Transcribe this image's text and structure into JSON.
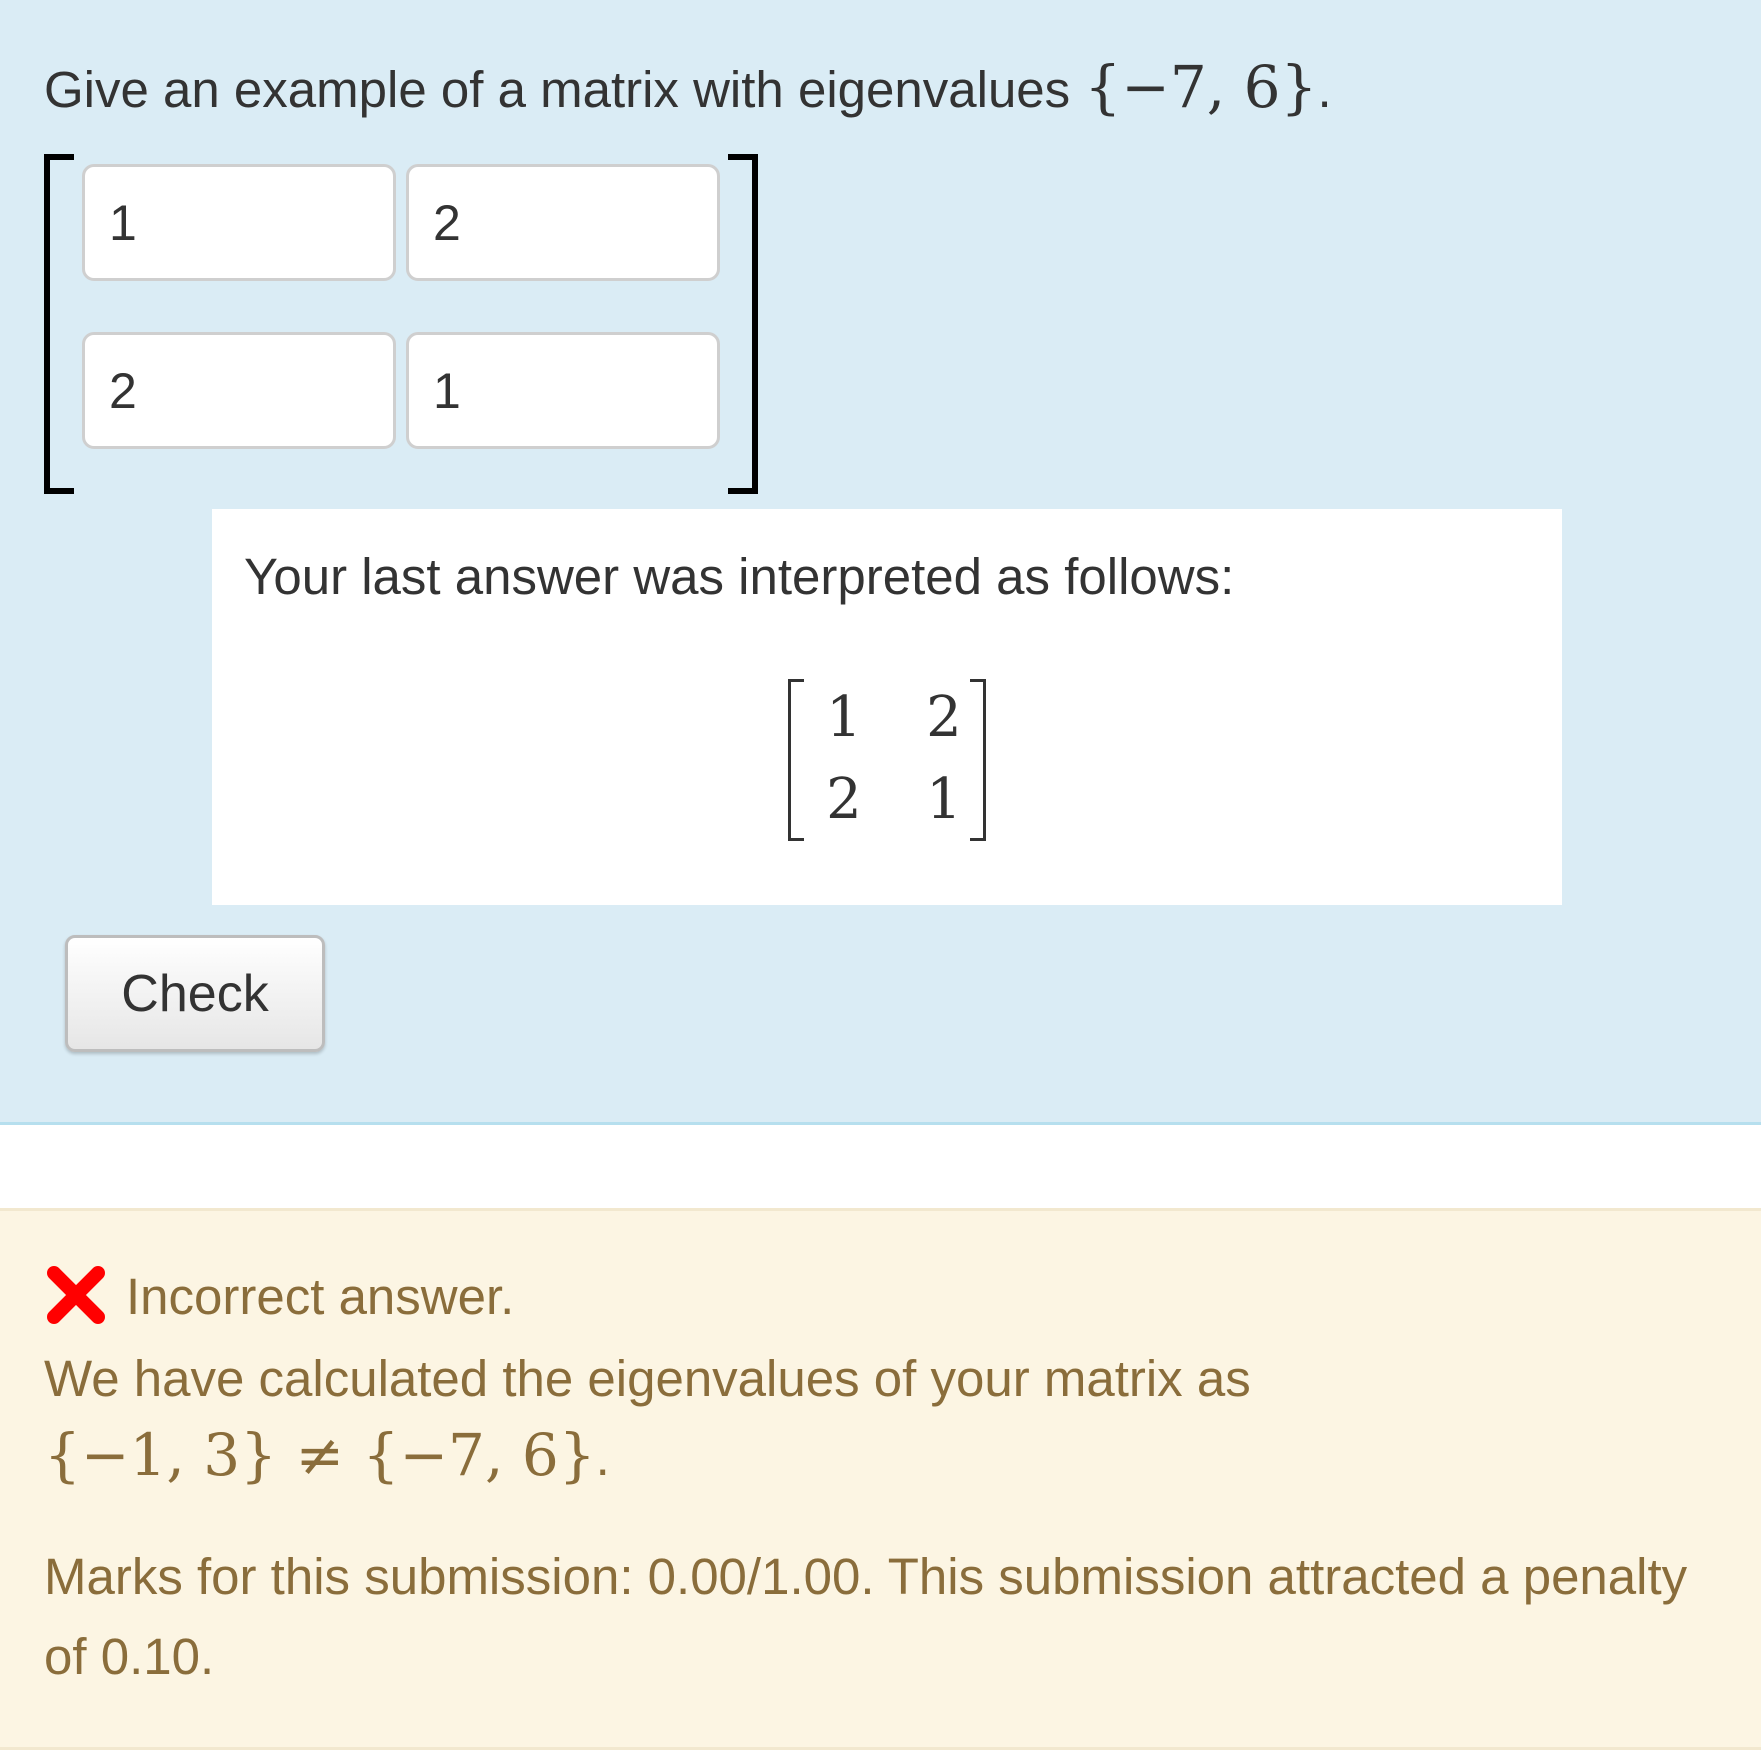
{
  "question": {
    "text": "Give an example of a matrix with eigenvalues ",
    "math": "{−7, 6}",
    "end": "."
  },
  "matrix_inputs": {
    "r1c1": "1",
    "r1c2": "2",
    "r2c1": "2",
    "r2c2": "1"
  },
  "validation": {
    "text": "Your last answer was interpreted as follows:",
    "matrix": {
      "r1c1": "1",
      "r1c2": "2",
      "r2c1": "2",
      "r2c2": "1"
    }
  },
  "check_button": {
    "label": "Check"
  },
  "feedback": {
    "status": "Incorrect answer.",
    "explanation_text": "We have calculated the eigenvalues of your matrix as",
    "explanation_math": "{−1, 3} ≠ {−7, 6}",
    "explanation_end": ".",
    "marks": "Marks for this submission: 0.00/1.00. This submission attracted a penalty of 0.10."
  },
  "colors": {
    "formulation_bg": "#daecf5",
    "feedback_bg": "#fcf5e3",
    "feedback_text": "#8a6d3b",
    "incorrect_icon": "#ff0000"
  },
  "icons": {
    "status": "cross-icon"
  }
}
